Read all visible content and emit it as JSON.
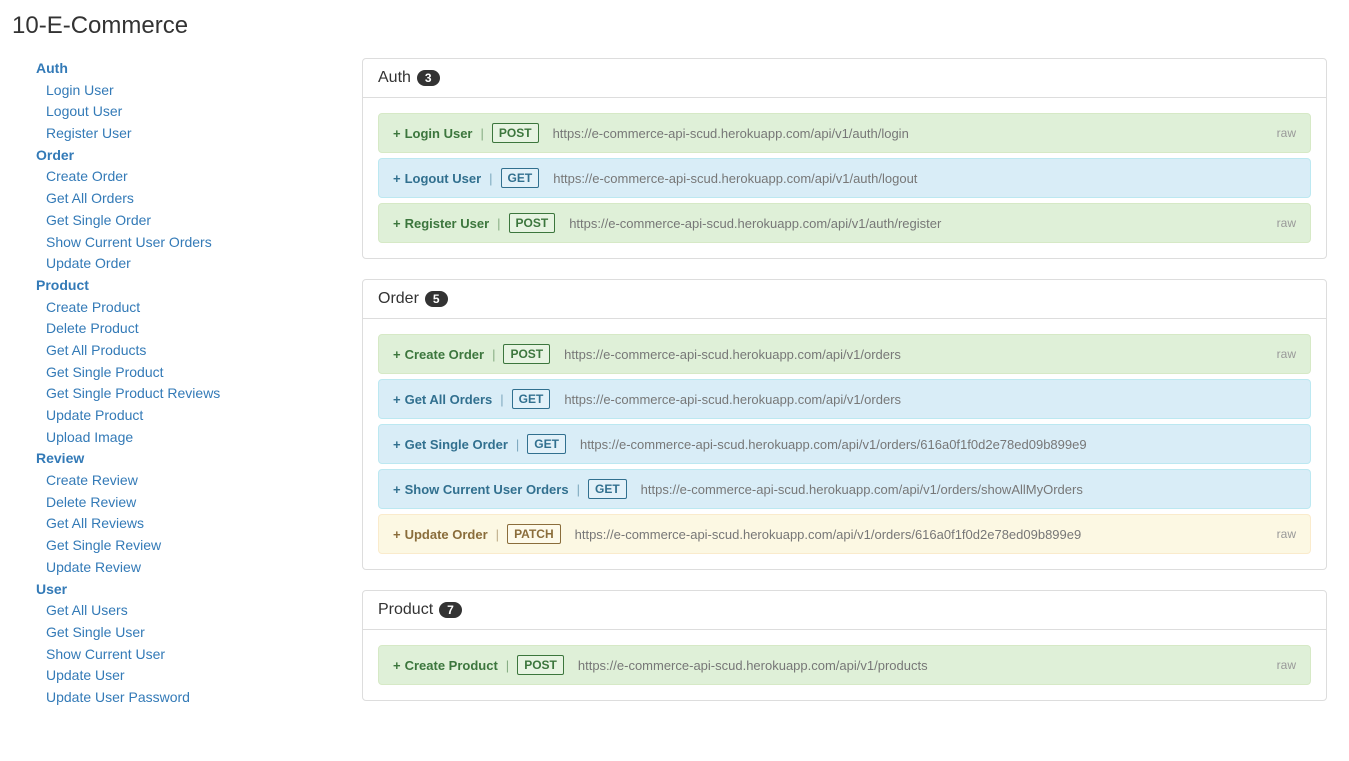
{
  "title": "10-E-Commerce",
  "raw_label": "raw",
  "plus": "+",
  "sep": "|",
  "sidebar": {
    "groups": [
      {
        "title": "Auth",
        "items": [
          "Login User",
          "Logout User",
          "Register User"
        ]
      },
      {
        "title": "Order",
        "items": [
          "Create Order",
          "Get All Orders",
          "Get Single Order",
          "Show Current User Orders",
          "Update Order"
        ]
      },
      {
        "title": "Product",
        "items": [
          "Create Product",
          "Delete Product",
          "Get All Products",
          "Get Single Product",
          "Get Single Product Reviews",
          "Update Product",
          "Upload Image"
        ]
      },
      {
        "title": "Review",
        "items": [
          "Create Review",
          "Delete Review",
          "Get All Reviews",
          "Get Single Review",
          "Update Review"
        ]
      },
      {
        "title": "User",
        "items": [
          "Get All Users",
          "Get Single User",
          "Show Current User",
          "Update User",
          "Update User Password"
        ]
      }
    ]
  },
  "sections": [
    {
      "title": "Auth",
      "count": "3",
      "endpoints": [
        {
          "name": "Login User",
          "method": "POST",
          "url": "https://e-commerce-api-scud.herokuapp.com/api/v1/auth/login",
          "has_raw": true
        },
        {
          "name": "Logout User",
          "method": "GET",
          "url": "https://e-commerce-api-scud.herokuapp.com/api/v1/auth/logout",
          "has_raw": false
        },
        {
          "name": "Register User",
          "method": "POST",
          "url": "https://e-commerce-api-scud.herokuapp.com/api/v1/auth/register",
          "has_raw": true
        }
      ]
    },
    {
      "title": "Order",
      "count": "5",
      "endpoints": [
        {
          "name": "Create Order",
          "method": "POST",
          "url": "https://e-commerce-api-scud.herokuapp.com/api/v1/orders",
          "has_raw": true
        },
        {
          "name": "Get All Orders",
          "method": "GET",
          "url": "https://e-commerce-api-scud.herokuapp.com/api/v1/orders",
          "has_raw": false
        },
        {
          "name": "Get Single Order",
          "method": "GET",
          "url": "https://e-commerce-api-scud.herokuapp.com/api/v1/orders/616a0f1f0d2e78ed09b899e9",
          "has_raw": false
        },
        {
          "name": "Show Current User Orders",
          "method": "GET",
          "url": "https://e-commerce-api-scud.herokuapp.com/api/v1/orders/showAllMyOrders",
          "has_raw": false
        },
        {
          "name": "Update Order",
          "method": "PATCH",
          "url": "https://e-commerce-api-scud.herokuapp.com/api/v1/orders/616a0f1f0d2e78ed09b899e9",
          "has_raw": true
        }
      ]
    },
    {
      "title": "Product",
      "count": "7",
      "endpoints": [
        {
          "name": "Create Product",
          "method": "POST",
          "url": "https://e-commerce-api-scud.herokuapp.com/api/v1/products",
          "has_raw": true
        }
      ]
    }
  ]
}
